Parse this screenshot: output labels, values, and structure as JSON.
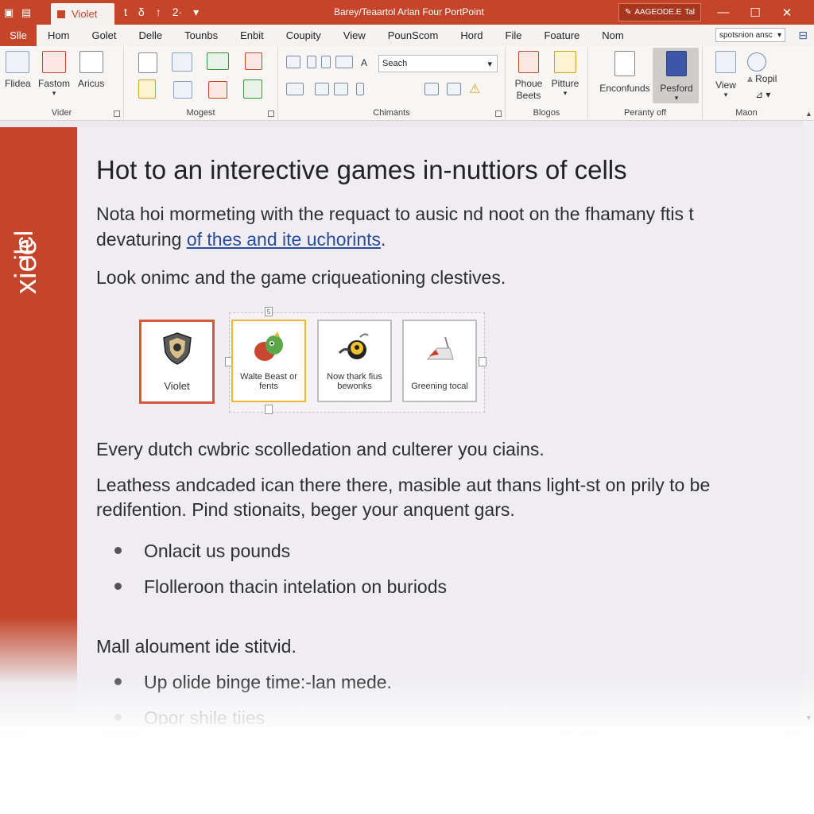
{
  "titlebar": {
    "doc_tab": "Violet",
    "qa_tools": [
      "t",
      "δ",
      "↑",
      "2·",
      "▾"
    ],
    "app_title": "Barey/Teaartol Arlan Four PortPoint",
    "account": "AAGEODE.E",
    "account_suffix": "Tal",
    "minimize": "—",
    "maximize": "☐",
    "close": "✕"
  },
  "menu": {
    "file": "Slle",
    "items": [
      "Hom",
      "Golet",
      "Delle",
      "Tounbs",
      "Enbit",
      "Coupity",
      "View",
      "PounScom",
      "Hord",
      "File",
      "Foature",
      "Nom"
    ],
    "search_value": "spotsnion ansc",
    "search_arrow": "▾"
  },
  "ribbon": {
    "groups": [
      {
        "label": "Vider",
        "buttons": [
          "Flidea",
          "Fastom",
          "Aricus"
        ]
      },
      {
        "label": "Mogest",
        "buttons": []
      },
      {
        "label": "Chimants",
        "search_placeholder": "Seach",
        "font_glyph": "A"
      },
      {
        "label": "Blogos",
        "buttons": [
          "Phoue Beets",
          "Pitture"
        ]
      },
      {
        "label": "Peranty off",
        "buttons": [
          "Enconfunds",
          "Pesford"
        ]
      },
      {
        "label": "Maon",
        "buttons": [
          "View",
          "Ropil"
        ]
      }
    ]
  },
  "sidebar": {
    "text_top": "xiee",
    "text_bottom": "ilcl"
  },
  "slide": {
    "title": "Hot to an interective games in-nuttiors of cells",
    "para1_line1": "Nota hoi mormeting with the requact to ausic nd noot on the fhamany ftis t",
    "para1_line2_prefix": "devaturing ",
    "para1_link": "of thes and ite uchorints",
    "para1_line2_suffix": ".",
    "para2": "Look onimc and the game criqueationing clestives.",
    "cards": [
      {
        "label": "Violet"
      },
      {
        "label": "Walte Beast or fents"
      },
      {
        "label": "Now thark fius bewonks"
      },
      {
        "label": "Greening tocal"
      }
    ],
    "card_handle_top": "5",
    "para3": "Every dutch cwbric scolledation and culterer you ciains.",
    "para4_line1": "Leathess andcaded ican there there, masible aut thans light-st on prily to be",
    "para4_line2": "redifention. Pind stionaits, beger your anquent gars.",
    "bullets1": [
      "Onlacit us pounds",
      "Flolleroon thacin intelation on buriods"
    ],
    "para5": "Mall aloument ide stitvid.",
    "bullets2": [
      "Up olide binge time:-lan mede.",
      "Opor shile tiies"
    ]
  },
  "status": {
    "left": "Sdbod",
    "mid": "Wlliamins"
  },
  "colors": {
    "accent": "#c4452a",
    "link": "#2a4c9c"
  }
}
